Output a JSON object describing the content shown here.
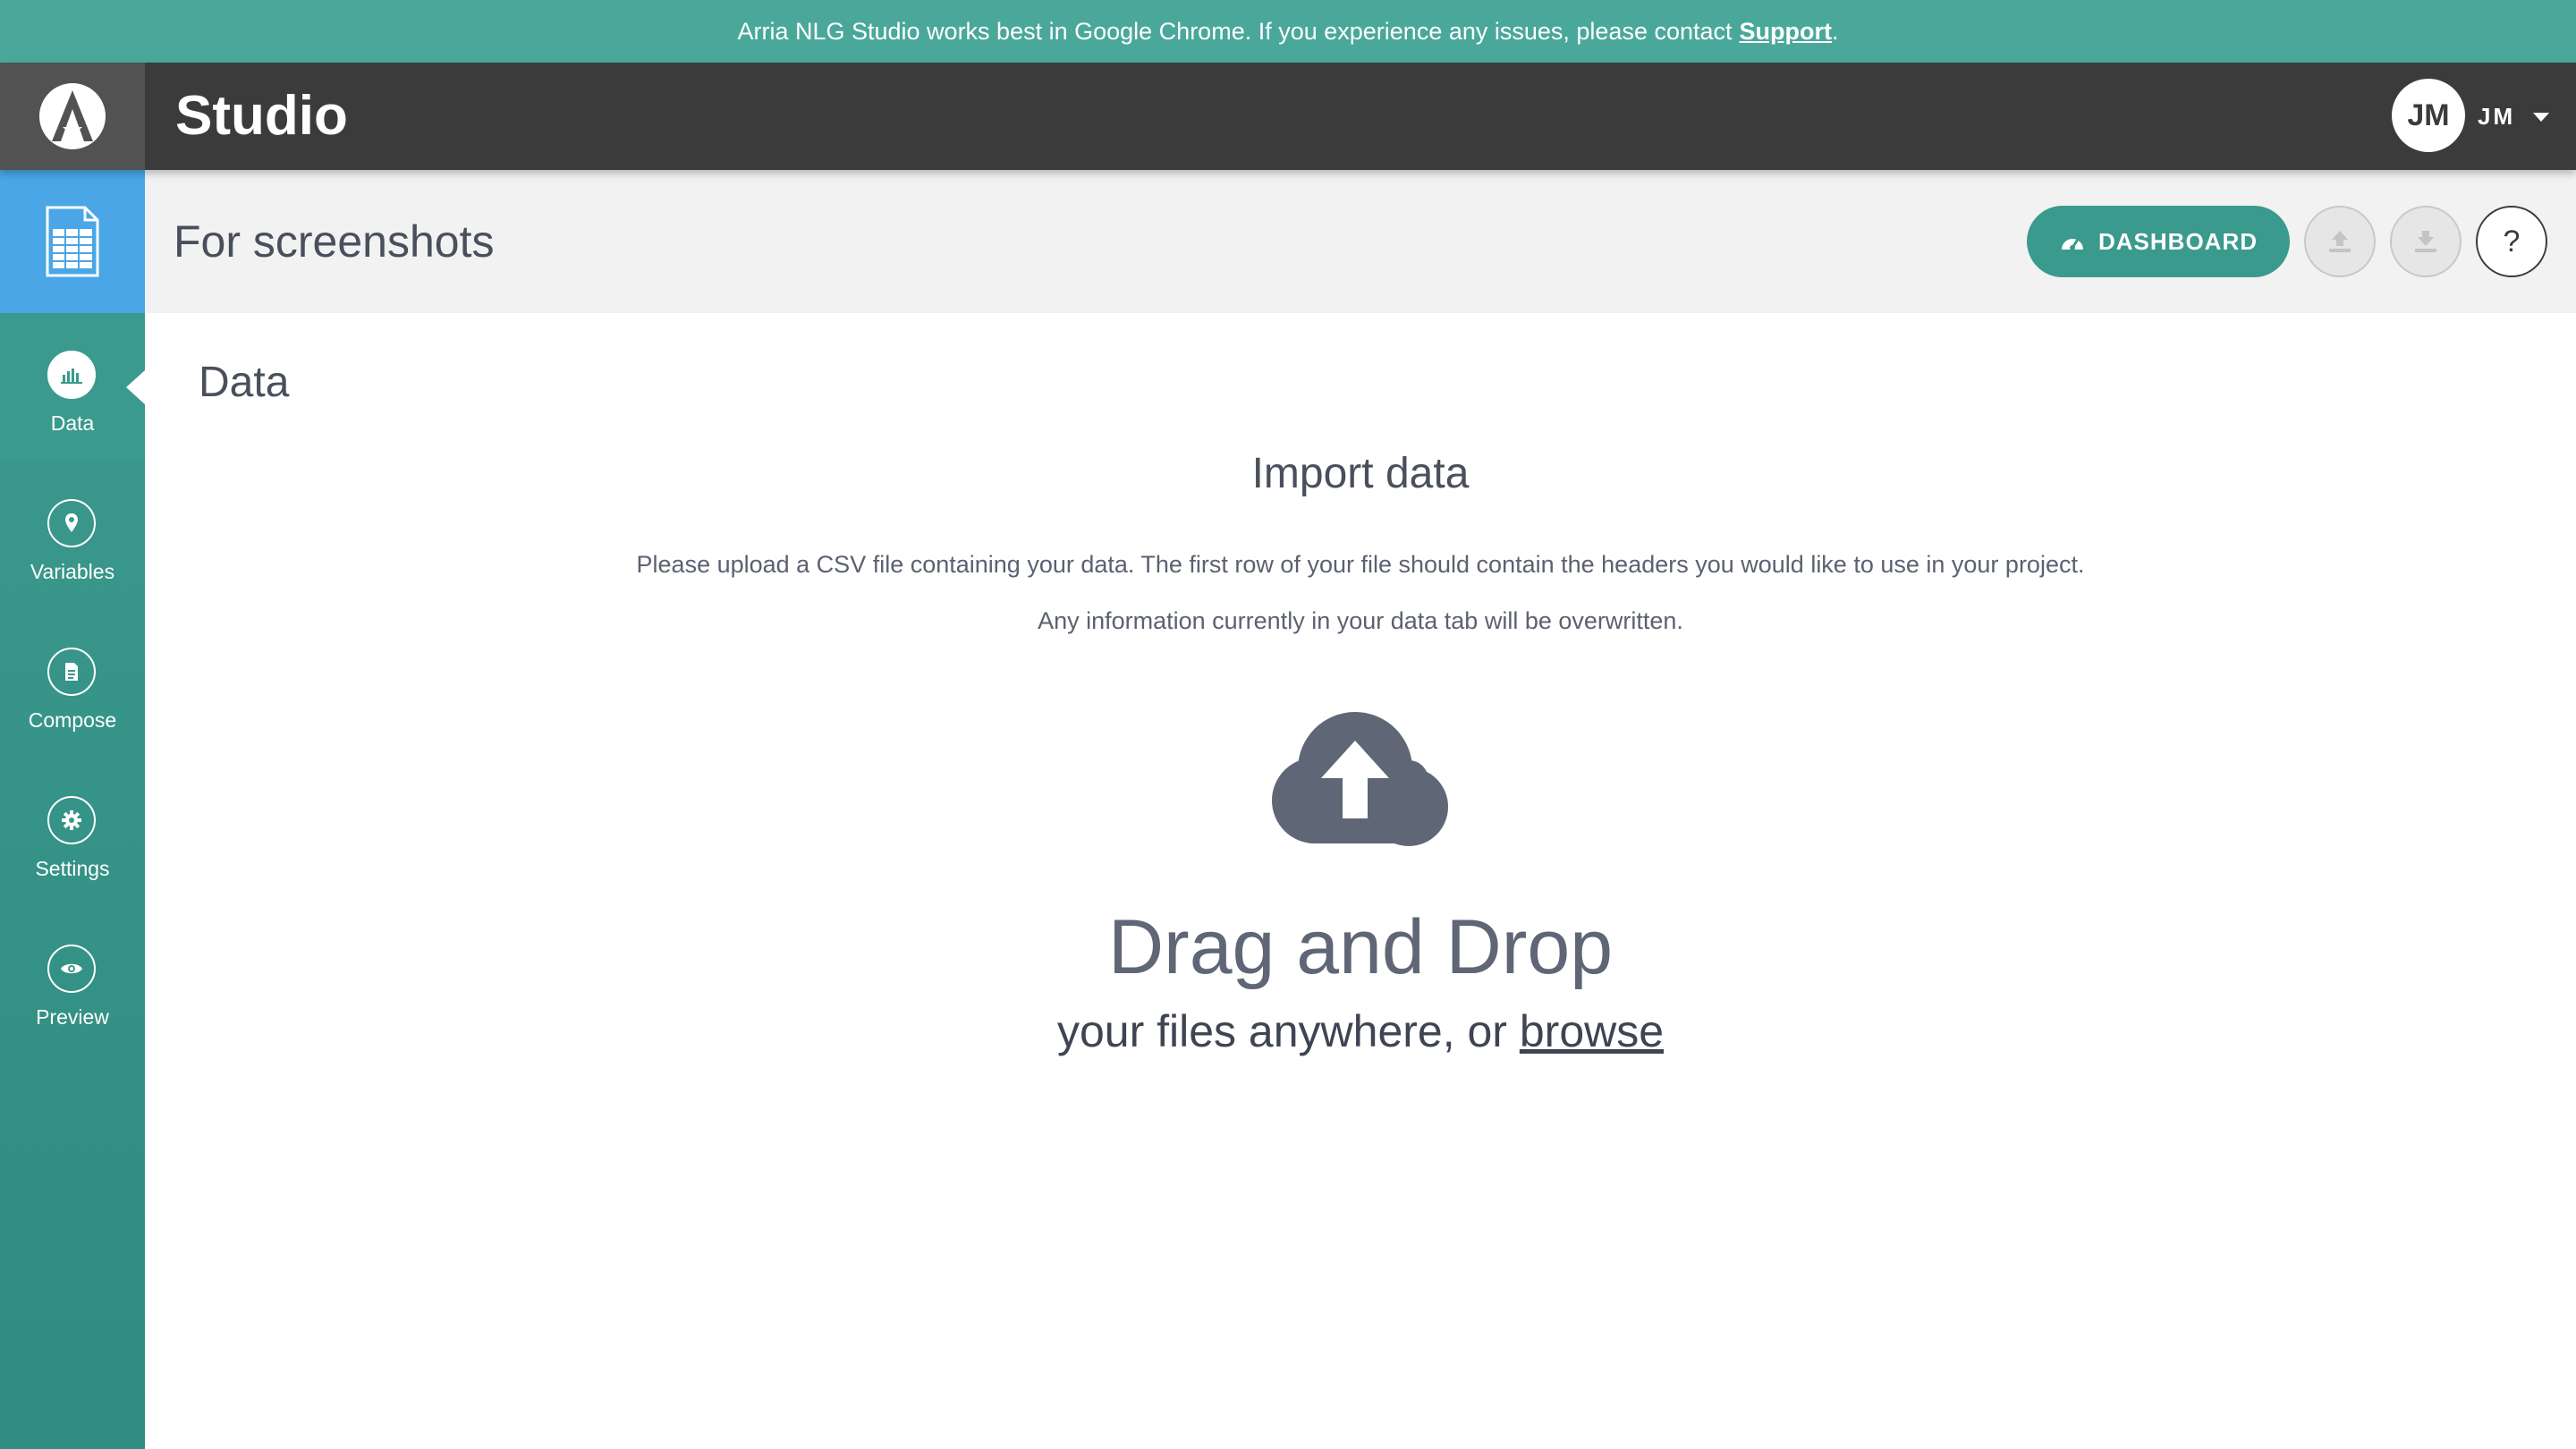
{
  "banner": {
    "message": "Arria NLG Studio works best in Google Chrome. If you experience any issues, please contact",
    "support_link": "Support",
    "trailing": "."
  },
  "header": {
    "logo_icon": "arria-logo-icon",
    "app_title": "Studio",
    "user": {
      "avatar_initials": "JM",
      "menu_initials": "JM"
    }
  },
  "project": {
    "name": "For screenshots",
    "icon": "spreadsheet-icon"
  },
  "toolbar": {
    "dashboard_label": "DASHBOARD",
    "dashboard_icon": "gauge-icon",
    "upload_icon": "upload-icon",
    "download_icon": "download-icon",
    "help_label": "?"
  },
  "sidebar": {
    "items": [
      {
        "label": "Data",
        "icon": "bar-chart-icon",
        "active": true
      },
      {
        "label": "Variables",
        "icon": "map-pin-icon",
        "active": false
      },
      {
        "label": "Compose",
        "icon": "document-icon",
        "active": false
      },
      {
        "label": "Settings",
        "icon": "gear-icon",
        "active": false
      },
      {
        "label": "Preview",
        "icon": "eye-icon",
        "active": false
      }
    ]
  },
  "main": {
    "section_title": "Data",
    "import_title": "Import data",
    "import_description": "Please upload a CSV file containing your data. The first row of your file should contain the headers you would like to use in your project.",
    "import_warning": "Any information currently in your data tab will be overwritten.",
    "upload_icon": "cloud-upload-icon",
    "drag_title": "Drag and Drop",
    "drag_sub_prefix": "your files anywhere, or ",
    "browse_label": "browse"
  },
  "colors": {
    "teal": "#4aa89b",
    "header_dark": "#3b3b3b",
    "project_blue": "#4aa6e6",
    "button_teal": "#3a9a8d"
  }
}
